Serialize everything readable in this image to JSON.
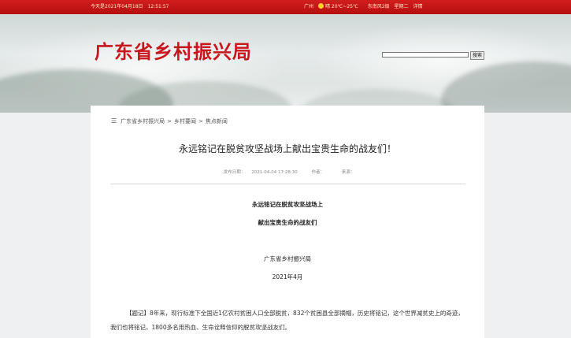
{
  "topbar": {
    "date": "今天是2021年04月18日",
    "time": "12:51:57",
    "city": "广州",
    "weather": "晴 20℃~25℃",
    "wind": "东南风2级",
    "weekday": "星期二",
    "detail_link": "详情"
  },
  "header": {
    "site_title": "广东省乡村振兴局",
    "search_placeholder": "",
    "search_button": "搜索"
  },
  "breadcrumb": {
    "items": [
      "广东省乡村振兴局",
      "乡村要闻",
      "焦点新闻"
    ],
    "separator": ">"
  },
  "article": {
    "title": "永远铭记在脱贫攻坚战场上献出宝贵生命的战友们！",
    "meta": {
      "publish_label": "发布日期：",
      "publish_value": "2021-04-04 17:28:30",
      "author_label": "作者：",
      "author_value": "",
      "source_label": "来源："
    },
    "subtitle_line1": "永远铭记在脱贫攻坚战场上",
    "subtitle_line2": "献出宝贵生命的战友们",
    "byline": "广东省乡村振兴局",
    "date": "2021年4月",
    "paragraph": "【题记】8年来，现行标准下全国近1亿农村贫困人口全部脱贫，832个贫困县全部摘帽，历史将铭记，这个世界减贫史上的奇迹，我们也将铭记，1800多名用热血、生命诠释信仰的脱贫攻坚战友们。"
  }
}
